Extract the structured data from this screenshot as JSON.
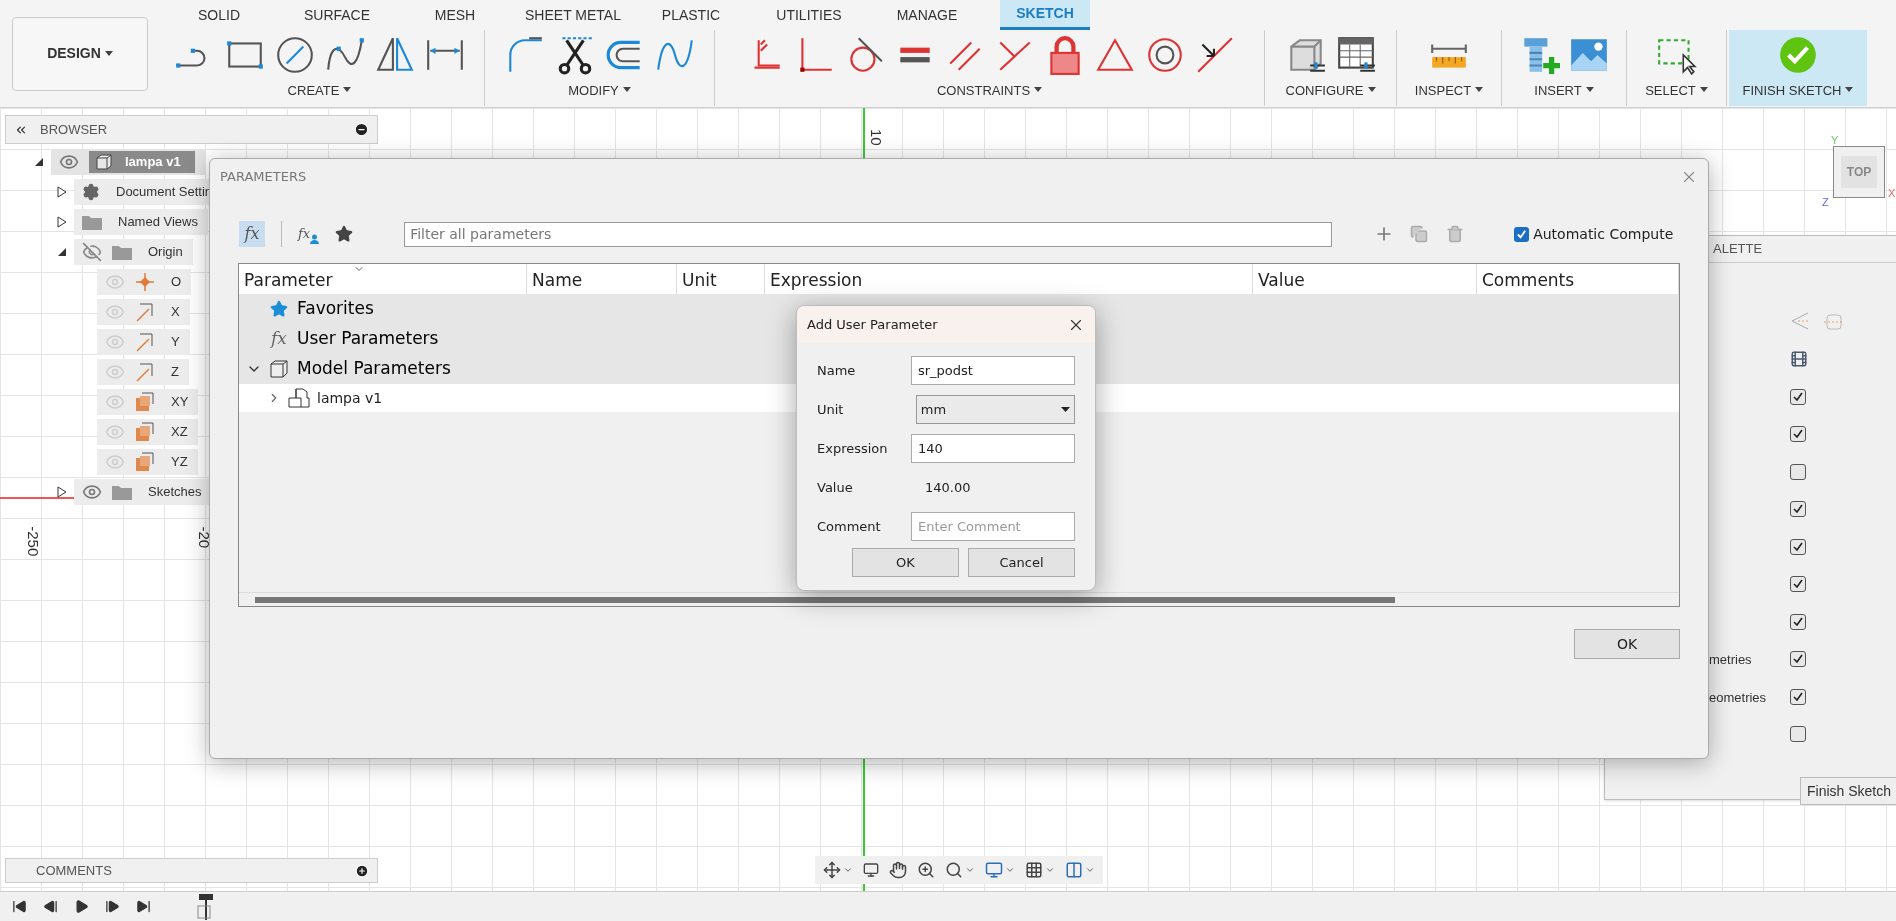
{
  "workspace": {
    "label": "DESIGN"
  },
  "tabs": [
    {
      "label": "SOLID",
      "selected": false
    },
    {
      "label": "SURFACE",
      "selected": false
    },
    {
      "label": "MESH",
      "selected": false
    },
    {
      "label": "SHEET METAL",
      "selected": false
    },
    {
      "label": "PLASTIC",
      "selected": false
    },
    {
      "label": "UTILITIES",
      "selected": false
    },
    {
      "label": "MANAGE",
      "selected": false
    },
    {
      "label": "SKETCH",
      "selected": true
    }
  ],
  "tool_groups": [
    {
      "label": "CREATE",
      "kind": "create"
    },
    {
      "label": "MODIFY",
      "kind": "modify"
    },
    {
      "label": "CONSTRAINTS",
      "kind": "constraints"
    },
    {
      "label": "CONFIGURE",
      "kind": "configure"
    },
    {
      "label": "INSPECT",
      "kind": "inspect"
    },
    {
      "label": "INSERT",
      "kind": "insert"
    },
    {
      "label": "SELECT",
      "kind": "select"
    },
    {
      "label": "FINISH SKETCH",
      "kind": "finish"
    }
  ],
  "browser": {
    "title": "BROWSER",
    "items": [
      {
        "label": "lampa v1",
        "kind": "component",
        "visible": true,
        "greyed": false,
        "expanded": true,
        "selected": true,
        "children": [
          {
            "label": "Document Settin",
            "kind": "settings",
            "expanded": false,
            "selected": false
          },
          {
            "label": "Named Views",
            "kind": "folder",
            "expanded": false,
            "selected": false
          },
          {
            "label": "Origin",
            "kind": "folder",
            "visible": false,
            "greyed": false,
            "expanded": true,
            "selected": false,
            "children": [
              {
                "label": "O",
                "kind": "point",
                "visible": true,
                "greyed": true,
                "selected": false
              },
              {
                "label": "X",
                "kind": "axis",
                "visible": true,
                "greyed": true,
                "selected": false
              },
              {
                "label": "Y",
                "kind": "axis",
                "visible": true,
                "greyed": true,
                "selected": false
              },
              {
                "label": "Z",
                "kind": "axis",
                "visible": true,
                "greyed": true,
                "selected": false
              },
              {
                "label": "XY",
                "kind": "plane",
                "visible": true,
                "greyed": true,
                "selected": false
              },
              {
                "label": "XZ",
                "kind": "plane",
                "visible": true,
                "greyed": true,
                "selected": false
              },
              {
                "label": "YZ",
                "kind": "plane",
                "visible": true,
                "greyed": true,
                "selected": false
              }
            ]
          },
          {
            "label": "Sketches",
            "kind": "folder",
            "visible": true,
            "greyed": false,
            "expanded": false,
            "selected": false
          }
        ]
      }
    ]
  },
  "canvas": {
    "axis_labels": [
      "-250",
      "-20",
      "10"
    ],
    "view_cube": {
      "face": "TOP",
      "axis_y": "Y",
      "axis_z": "Z",
      "axis_x": "X"
    }
  },
  "comments": {
    "title": "COMMENTS"
  },
  "palette": {
    "title": "ALETTE",
    "rows": [
      {
        "kind": "icons"
      },
      {
        "kind": "icon"
      },
      {
        "kind": "check",
        "checked": true
      },
      {
        "kind": "check",
        "checked": true
      },
      {
        "kind": "check",
        "checked": false
      },
      {
        "kind": "check",
        "checked": true
      },
      {
        "kind": "check",
        "checked": true
      },
      {
        "kind": "check",
        "checked": true
      },
      {
        "kind": "check",
        "checked": true
      },
      {
        "kind": "check",
        "label": "metries",
        "checked": true
      },
      {
        "kind": "check",
        "label": "eometries",
        "checked": true
      },
      {
        "kind": "check",
        "checked": false
      }
    ],
    "button": "Finish Sketch"
  },
  "parameters_dialog": {
    "title": "PARAMETERS",
    "all_symbol": "fx",
    "user_symbol": "fx",
    "filter": {
      "placeholder": "Filter all parameters"
    },
    "auto_compute": {
      "label": "Automatic Compute",
      "checked": true
    },
    "columns": [
      "Parameter",
      "Name",
      "Unit",
      "Expression",
      "Value",
      "Comments"
    ],
    "rows": [
      {
        "label": "Favorites",
        "kind": "favorites"
      },
      {
        "label": "User Parameters",
        "kind": "user",
        "symbol": "fx"
      },
      {
        "label": "Model Parameters",
        "kind": "model",
        "expanded": true,
        "children": [
          {
            "label": "lampa v1",
            "kind": "component",
            "expanded": false
          }
        ]
      }
    ],
    "ok": "OK"
  },
  "add_dialog": {
    "title": "Add User Parameter",
    "fields": [
      {
        "label": "Name",
        "kind": "text",
        "value": "sr_podst"
      },
      {
        "label": "Unit",
        "kind": "select",
        "value": "mm"
      },
      {
        "label": "Expression",
        "kind": "text",
        "value": "140"
      },
      {
        "label": "Value",
        "kind": "readout",
        "value": "140.00"
      },
      {
        "label": "Comment",
        "kind": "text",
        "placeholder": "Enter Comment"
      }
    ],
    "buttons": [
      "OK",
      "Cancel"
    ]
  }
}
